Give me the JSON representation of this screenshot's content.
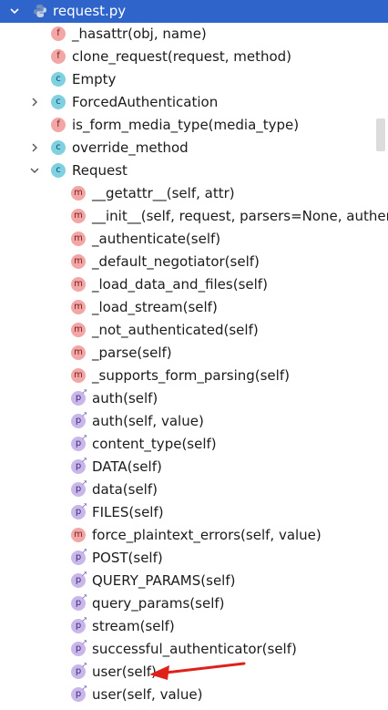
{
  "file": {
    "name": "request.py"
  },
  "items": [
    {
      "kind": "f",
      "label": "_hasattr(obj, name)",
      "indent": 1,
      "expander": ""
    },
    {
      "kind": "f",
      "label": "clone_request(request, method)",
      "indent": 1,
      "expander": ""
    },
    {
      "kind": "c",
      "label": "Empty",
      "indent": 1,
      "expander": ""
    },
    {
      "kind": "c",
      "label": "ForcedAuthentication",
      "indent": 1,
      "expander": "collapsed"
    },
    {
      "kind": "f",
      "label": "is_form_media_type(media_type)",
      "indent": 1,
      "expander": ""
    },
    {
      "kind": "c",
      "label": "override_method",
      "indent": 1,
      "expander": "collapsed"
    },
    {
      "kind": "c",
      "label": "Request",
      "indent": 1,
      "expander": "expanded"
    },
    {
      "kind": "m",
      "label": "__getattr__(self, attr)",
      "indent": 2,
      "expander": ""
    },
    {
      "kind": "m",
      "label": "__init__(self, request, parsers=None, authent",
      "indent": 2,
      "expander": ""
    },
    {
      "kind": "m",
      "label": "_authenticate(self)",
      "indent": 2,
      "expander": ""
    },
    {
      "kind": "m",
      "label": "_default_negotiator(self)",
      "indent": 2,
      "expander": ""
    },
    {
      "kind": "m",
      "label": "_load_data_and_files(self)",
      "indent": 2,
      "expander": ""
    },
    {
      "kind": "m",
      "label": "_load_stream(self)",
      "indent": 2,
      "expander": ""
    },
    {
      "kind": "m",
      "label": "_not_authenticated(self)",
      "indent": 2,
      "expander": ""
    },
    {
      "kind": "m",
      "label": "_parse(self)",
      "indent": 2,
      "expander": ""
    },
    {
      "kind": "m",
      "label": "_supports_form_parsing(self)",
      "indent": 2,
      "expander": ""
    },
    {
      "kind": "p",
      "label": "auth(self)",
      "indent": 2,
      "expander": ""
    },
    {
      "kind": "p",
      "label": "auth(self, value)",
      "indent": 2,
      "expander": ""
    },
    {
      "kind": "p",
      "label": "content_type(self)",
      "indent": 2,
      "expander": ""
    },
    {
      "kind": "p",
      "label": "DATA(self)",
      "indent": 2,
      "expander": ""
    },
    {
      "kind": "p",
      "label": "data(self)",
      "indent": 2,
      "expander": ""
    },
    {
      "kind": "p",
      "label": "FILES(self)",
      "indent": 2,
      "expander": ""
    },
    {
      "kind": "m",
      "label": "force_plaintext_errors(self, value)",
      "indent": 2,
      "expander": ""
    },
    {
      "kind": "p",
      "label": "POST(self)",
      "indent": 2,
      "expander": ""
    },
    {
      "kind": "p",
      "label": "QUERY_PARAMS(self)",
      "indent": 2,
      "expander": ""
    },
    {
      "kind": "p",
      "label": "query_params(self)",
      "indent": 2,
      "expander": ""
    },
    {
      "kind": "p",
      "label": "stream(self)",
      "indent": 2,
      "expander": ""
    },
    {
      "kind": "p",
      "label": "successful_authenticator(self)",
      "indent": 2,
      "expander": ""
    },
    {
      "kind": "p",
      "label": "user(self)",
      "indent": 2,
      "expander": ""
    },
    {
      "kind": "p",
      "label": "user(self, value)",
      "indent": 2,
      "expander": ""
    }
  ],
  "colors": {
    "selected_row": "#2f65ca",
    "annotation_arrow": "#e0201a"
  }
}
